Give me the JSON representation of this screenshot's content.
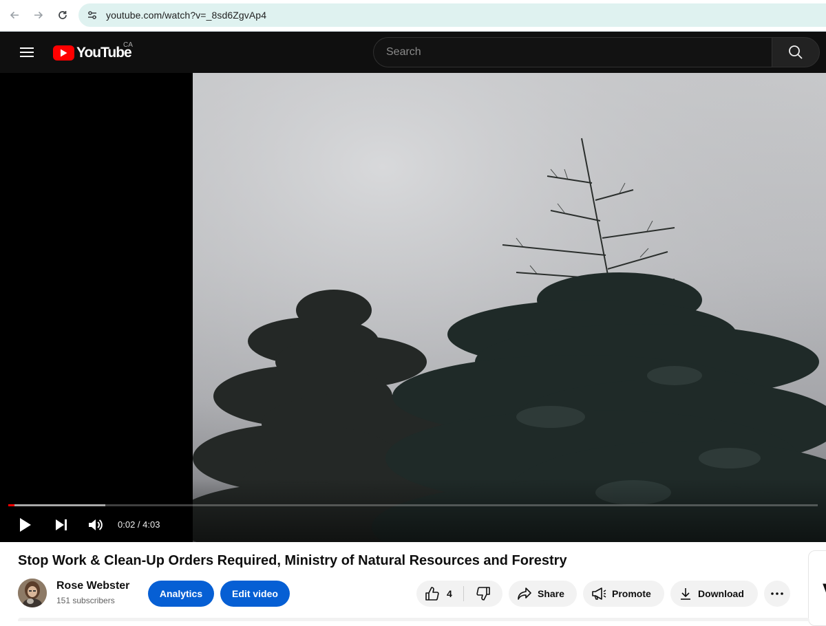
{
  "browser": {
    "url": "youtube.com/watch?v=_8sd6ZgvAp4",
    "icons": [
      "back-arrow-icon",
      "forward-arrow-icon",
      "reload-icon",
      "site-settings-icon"
    ]
  },
  "header": {
    "logo_text": "YouTube",
    "country_code": "CA",
    "search_placeholder": "Search",
    "colors": {
      "background": "#0f0f0f",
      "logo_red": "#ff0000"
    }
  },
  "player": {
    "current_time": "0:02",
    "duration": "4:03",
    "time_display": "0:02 / 4:03",
    "progress_fraction": 0.008,
    "buffered_fraction": 0.12,
    "colors": {
      "progress": "#ff0000"
    }
  },
  "video": {
    "title": "Stop Work & Clean-Up Orders Required, Ministry of Natural Resources and Forestry",
    "channel_name": "Rose Webster",
    "subscribers": "151 subscribers"
  },
  "actions": {
    "analytics_label": "Analytics",
    "edit_video_label": "Edit video",
    "like_count": "4",
    "share_label": "Share",
    "promote_label": "Promote",
    "download_label": "Download",
    "colors": {
      "primary_button": "#065fd4"
    }
  },
  "side_card": {
    "letter": "V"
  }
}
